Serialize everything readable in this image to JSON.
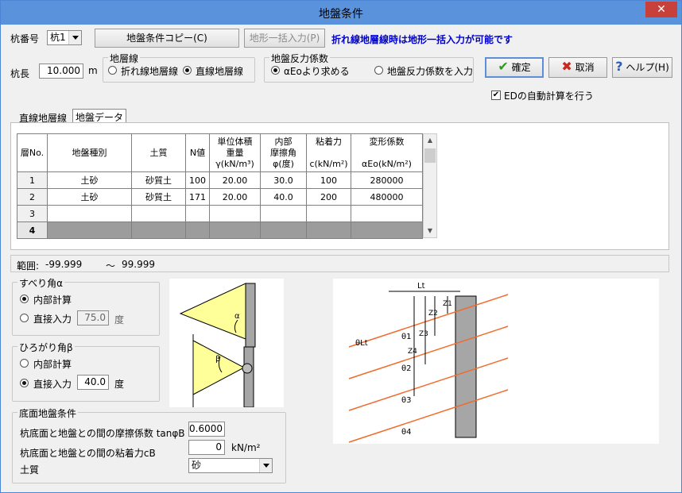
{
  "window": {
    "title": "地盤条件",
    "close_glyph": "✕"
  },
  "pile": {
    "label": "杭番号",
    "selected": "杭1"
  },
  "top_buttons": {
    "copy": "地盤条件コピー(C)",
    "terrain": "地形一括入力(P)"
  },
  "notice": "折れ線地層線時は地形一括入力が可能です",
  "pile_length": {
    "label": "杭長",
    "value": "10.000",
    "unit": "m"
  },
  "layer_line": {
    "title": "地層線",
    "options": [
      "折れ線地層線",
      "直線地層線"
    ],
    "selected": 1
  },
  "reaction": {
    "title": "地盤反力係数",
    "options": [
      "αEoより求める",
      "地盤反力係数を入力"
    ],
    "selected": 0
  },
  "actions": {
    "ok": "確定",
    "cancel": "取消",
    "help": "ヘルプ(H)"
  },
  "ed_auto": {
    "label": "EDの自動計算を行う",
    "checked": true
  },
  "tabs": [
    "直線地層線",
    "地盤データ"
  ],
  "active_tab": 1,
  "table": {
    "headers": [
      "層No.",
      "地盤種別",
      "土質",
      "N値",
      "単位体積\n重量\nγ(kN/m³)",
      "内部\n摩擦角\nφ(度)",
      "粘着力\n\nc(kN/m²)",
      "変形係数\n\nαEo(kN/m²)"
    ],
    "rows": [
      [
        "1",
        "土砂",
        "砂質土",
        "100",
        "20.00",
        "30.0",
        "100",
        "280000"
      ],
      [
        "2",
        "土砂",
        "砂質土",
        "171",
        "20.00",
        "40.0",
        "200",
        "480000"
      ],
      [
        "3",
        "",
        "",
        "",
        "",
        "",
        "",
        ""
      ],
      [
        "4",
        "",
        "",
        "",
        "",
        "",
        "",
        ""
      ]
    ]
  },
  "range": {
    "label": "範囲:",
    "min": "-99.999",
    "sep": "～",
    "max": "99.999"
  },
  "slide_angle": {
    "title": "すべり角α",
    "opt1": "内部計算",
    "opt2": "直接入力",
    "value": "75.0",
    "unit": "度",
    "selected": 0
  },
  "spread_angle": {
    "title": "ひろがり角β",
    "opt1": "内部計算",
    "opt2": "直接入力",
    "value": "40.0",
    "unit": "度",
    "selected": 1
  },
  "base": {
    "title": "底面地盤条件",
    "friction_label": "杭底面と地盤との間の摩擦係数 tanφB",
    "friction_value": "0.6000",
    "cohesion_label": "杭底面と地盤との間の粘着力cB",
    "cohesion_value": "0",
    "cohesion_unit": "kN/m²",
    "soil_label": "土質",
    "soil_value": "砂"
  },
  "diagram_labels": {
    "alpha": "α",
    "beta": "β",
    "Lt": "Lt",
    "thetaLt": "θLt",
    "theta": [
      "θ1",
      "θ2",
      "θ3",
      "θ4"
    ],
    "z": [
      "Z1",
      "Z2",
      "Z3",
      "Z4"
    ]
  },
  "colors": {
    "accent_blue": "#0000cc",
    "ok_green": "#2e9a1e",
    "cancel_red": "#c8281e",
    "help_blue": "#2b5fb5",
    "wedge_yellow": "#ffff99",
    "strata_orange": "#f26b2a"
  }
}
